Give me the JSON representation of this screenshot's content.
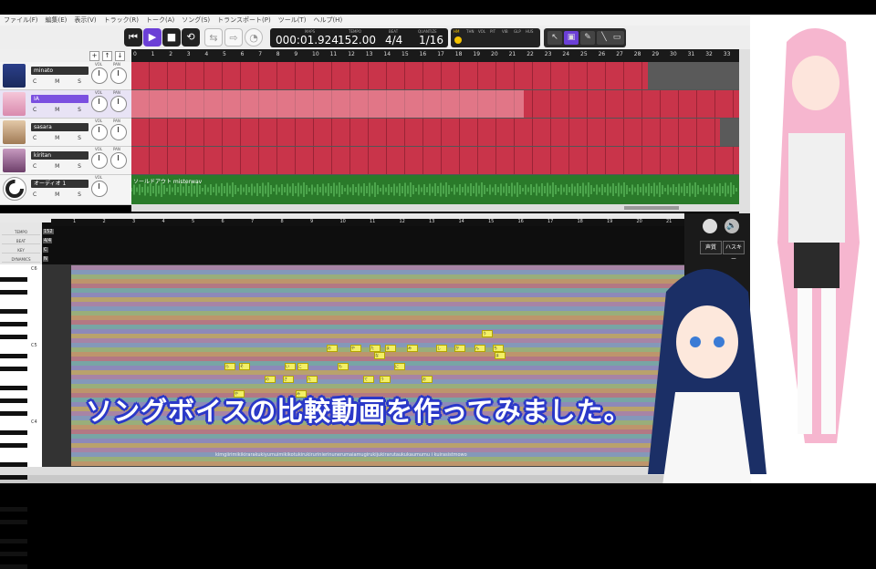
{
  "menu": [
    "ファイル(F)",
    "編集(E)",
    "表示(V)",
    "トラック(R)",
    "トーク(A)",
    "ソング(S)",
    "トランスポート(P)",
    "ツール(T)",
    "ヘルプ(H)"
  ],
  "readout": {
    "labels": [
      "MAPS",
      "TEMPO",
      "BEAT",
      "QUANTIZE"
    ],
    "time": "000:01.924",
    "tempo": "152.00",
    "beat": "4/4",
    "quantize": "1/16"
  },
  "status_labels": [
    "HM",
    "THN",
    "VOL",
    "PIT",
    "VIB",
    "GLP",
    "HUS"
  ],
  "tracks": [
    {
      "name": "minato",
      "color": "#4a6ab5"
    },
    {
      "name": "IA",
      "color": "#e6a8c8"
    },
    {
      "name": "sasara",
      "color": "#c9a27a"
    },
    {
      "name": "kiritan",
      "color": "#8a5a8a"
    },
    {
      "name": "オーディオ 1",
      "color": "#ffffff"
    }
  ],
  "track_buttons": "C M S",
  "knob_labels": {
    "vol": "VOL",
    "pan": "PAN"
  },
  "audio_clip_label": "ソールドアウト misterwav",
  "ruler_top": [
    "0",
    "1",
    "2",
    "3",
    "4",
    "5",
    "6",
    "7",
    "8",
    "9",
    "10",
    "11",
    "12",
    "13",
    "14",
    "15",
    "16",
    "17",
    "18",
    "19",
    "20",
    "21",
    "22",
    "23",
    "24",
    "25",
    "26",
    "27",
    "28",
    "29",
    "30",
    "31",
    "32",
    "33"
  ],
  "ruler_editor": [
    "1",
    "2",
    "3",
    "4",
    "5",
    "6",
    "7",
    "8",
    "9",
    "10",
    "11",
    "12",
    "13",
    "14",
    "15",
    "16",
    "17",
    "18",
    "19",
    "20",
    "21"
  ],
  "param_labels": [
    "TEMPO",
    "BEAT",
    "KEY",
    "DYNAMICS"
  ],
  "param_values": [
    "152",
    "4/4",
    "C",
    "N"
  ],
  "octaves": [
    "C6",
    "C5",
    "C4"
  ],
  "side_buttons": [
    "声質",
    "ハスキー"
  ],
  "lyrics": "kimgiirimikikirarakukiyumuimikikotukirukirurinierinunerumaiamugirukijukirarutaukukaumumu i kuirasistmowo",
  "subtitle": "ソングボイスの比較動画を作ってみました。",
  "notes": [
    "う",
    "お",
    "や",
    "た",
    "ま",
    "み",
    "し",
    "か",
    "ん",
    "ち",
    "な",
    "ら",
    "そ",
    "い",
    "こ",
    "も",
    "に",
    "の",
    "さ",
    "て"
  ]
}
